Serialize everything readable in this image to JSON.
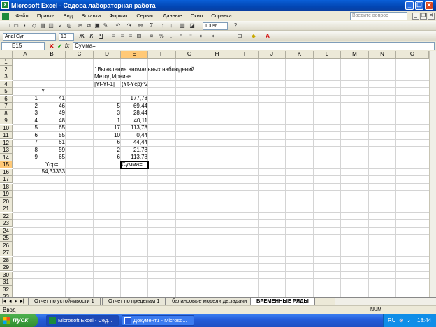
{
  "window": {
    "title": "Microsoft Excel - Седова лабораторная работа"
  },
  "menu": [
    "Файл",
    "Правка",
    "Вид",
    "Вставка",
    "Формат",
    "Сервис",
    "Данные",
    "Окно",
    "Справка"
  ],
  "ask": {
    "placeholder": "Введите вопрос"
  },
  "toolbar": {
    "zoom": "100%",
    "font_name": "Arial Cyr",
    "font_size": "10",
    "bold": "Ж",
    "italic": "К",
    "underline": "Ч",
    "sigma": "Σ"
  },
  "formula_bar": {
    "name_box": "E15",
    "fx": "fx",
    "content": "Сумма="
  },
  "columns": [
    "A",
    "B",
    "C",
    "D",
    "E",
    "F",
    "G",
    "H",
    "I",
    "J",
    "K",
    "L",
    "M",
    "N",
    "O"
  ],
  "rows": [
    "1",
    "2",
    "3",
    "4",
    "5",
    "6",
    "7",
    "8",
    "9",
    "10",
    "11",
    "12",
    "13",
    "14",
    "15",
    "16",
    "17",
    "18",
    "19",
    "20",
    "21",
    "22",
    "23",
    "24",
    "25",
    "26",
    "27",
    "28",
    "29",
    "30",
    "31",
    "32",
    "33"
  ],
  "cells": {
    "D2": "1Выявление аномальных наблюдений",
    "D3": "Метод Ирвина",
    "D4": "|Yt-Yt-1|",
    "E4": "(Yt-Yср)^2",
    "A5": "T",
    "B5": "Y",
    "A6": "",
    "B6": "41",
    "E6": "177,78",
    "A7": "2",
    "B7": "46",
    "D7": "5",
    "E7": "69,44",
    "A8": "3",
    "B8": "49",
    "D8": "3",
    "E8": "28,44",
    "A9": "4",
    "B9": "48",
    "D9": "1",
    "E9": "40,11",
    "A10": "5",
    "B10": "65",
    "D10": "17",
    "E10": "113,78",
    "A11": "6",
    "B11": "55",
    "D11": "10",
    "E11": "0,44",
    "A12": "7",
    "B12": "61",
    "D12": "6",
    "E12": "44,44",
    "A13": "8",
    "B13": "59",
    "D13": "2",
    "E13": "21,78",
    "A14": "9",
    "B14": "65",
    "D14": "6",
    "E14": "113,78",
    "B15": "Yср=",
    "E15": "Сумма=",
    "B16": "54,33333"
  },
  "cell_A6": "1",
  "sheet_tabs": [
    "Отчет по устойчивости 1",
    "Отчет по пределам 1",
    "балансовые модели дв.задачи",
    "ВРЕМЕННЫЕ РЯДЫ"
  ],
  "status": {
    "left": "Ввод",
    "num": "NUM"
  },
  "taskbar": {
    "start": "пуск",
    "btn1": "Microsoft Excel - Сед...",
    "btn2": "Документ1 - Microso...",
    "lang": "RU",
    "clock": "18:44"
  }
}
